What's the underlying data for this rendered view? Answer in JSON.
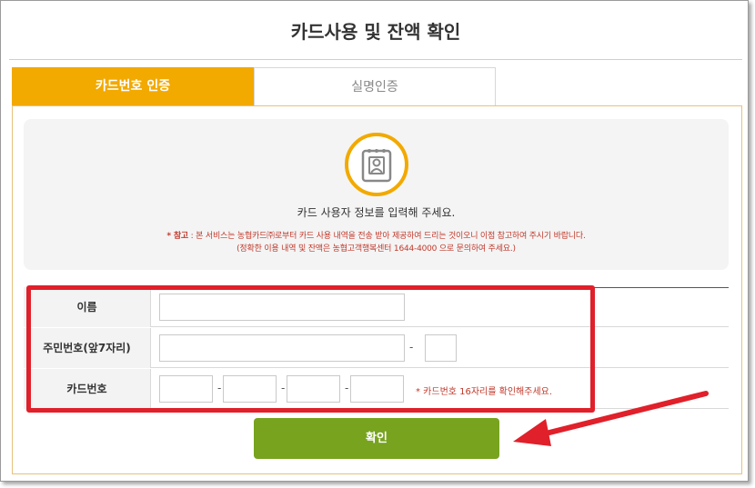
{
  "page": {
    "title": "카드사용 및 잔액 확인"
  },
  "tabs": [
    {
      "label": "카드번호 인증",
      "active": true
    },
    {
      "label": "실명인증",
      "active": false
    }
  ],
  "notice": {
    "icon": "user-card-icon",
    "main": "카드 사용자 정보를 입력해 주세요.",
    "ref_prefix": "* 참고",
    "ref_text": " : 본 서비스는 농협카드㈜로부터 카드 사용 내역을 전송 받아 제공하여 드리는 것이오니 이점 참고하여 주시기 바랍니다.",
    "ref_text2": "(정확한 이용 내역 및 잔액은 농협고객행복센터 1644-4000 으로 문의하여 주세요.)"
  },
  "form": {
    "name_label": "이름",
    "name_value": "",
    "rrn_label": "주민번호(앞7자리)",
    "rrn_front_value": "",
    "rrn_back_value": "",
    "rrn_separator": "-",
    "card_label": "카드번호",
    "card_parts": [
      "",
      "",
      "",
      ""
    ],
    "card_separator": "-",
    "card_hint": "* 카드번호 16자리를 확인해주세요."
  },
  "actions": {
    "confirm_label": "확인"
  },
  "colors": {
    "tab_active": "#f2a900",
    "confirm_button": "#77a31f",
    "highlight": "#e0202a"
  }
}
